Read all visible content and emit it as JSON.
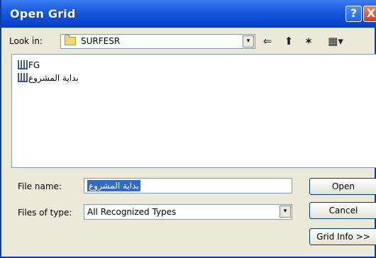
{
  "window": {
    "title": "Open Grid",
    "help_glyph": "?",
    "close_glyph": "X"
  },
  "lookin": {
    "label": "Look in:",
    "value": "SURFESR",
    "dropdown_glyph": "▾"
  },
  "toolbar": {
    "back_glyph": "⇐",
    "up_glyph": "⬆",
    "new_folder_glyph": "✶",
    "view_glyph": "▦▾"
  },
  "files": [
    {
      "name": "FG"
    },
    {
      "name": "بداية المشروع"
    }
  ],
  "filename": {
    "label": "File name:",
    "value": "بداية المشروع"
  },
  "filetype": {
    "label": "Files of type:",
    "value": "All Recognized Types",
    "dropdown_glyph": "▾"
  },
  "buttons": {
    "open": "Open",
    "cancel": "Cancel",
    "grid_info": "Grid Info >>"
  },
  "colors": {
    "titlebar": "#0d4bd6",
    "dialog_bg": "#ece9d8",
    "selection": "#316ac5",
    "close": "#c8401c"
  },
  "icons": {
    "folder": "folder-icon",
    "grid_file": "grid-file-icon"
  }
}
